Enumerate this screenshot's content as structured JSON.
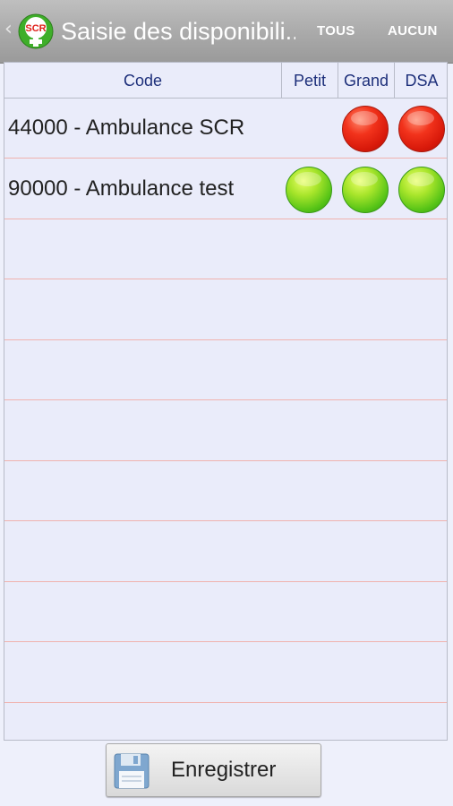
{
  "action_bar": {
    "back_glyph": "‹",
    "app_icon": "scr-ambulance-logo",
    "app_icon_text": "SCR",
    "title": "Saisie des disponibili...",
    "buttons": {
      "all": "TOUS",
      "none": "AUCUN"
    }
  },
  "table": {
    "columns": [
      "Code",
      "Petit",
      "Grand",
      "DSA"
    ],
    "rows": [
      {
        "label": "44000 - Ambulance SCR",
        "petit": null,
        "grand": "red",
        "dsa": "red"
      },
      {
        "label": "90000 - Ambulance test",
        "petit": "green",
        "grand": "green",
        "dsa": "green"
      }
    ],
    "empty_rows": 9
  },
  "status_colors": {
    "available": "#57c417",
    "unavailable": "#f2331c",
    "row_separator": "#f0b2ae"
  },
  "footer": {
    "save_label": "Enregistrer",
    "save_icon": "floppy-disk-icon"
  }
}
